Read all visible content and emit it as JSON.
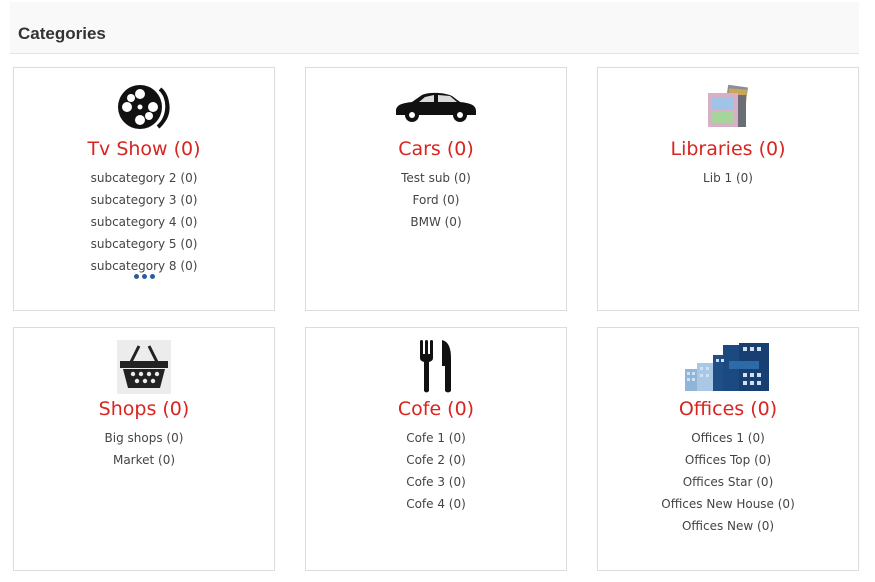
{
  "header": {
    "title": "Categories"
  },
  "more_label": "more",
  "colors": {
    "title": "#d9241f",
    "text": "#444444",
    "more_dots": "#2a5d9f"
  },
  "categories": [
    {
      "icon": "film-reel-icon",
      "title": "Tv Show (0)",
      "items": [
        "subcategory 2 (0)",
        "subcategory 3 (0)",
        "subcategory 4 (0)",
        "subcategory 5 (0)",
        "subcategory 8 (0)"
      ]
    },
    {
      "icon": "car-icon",
      "title": "Cars (0)",
      "items": [
        "Test sub (0)",
        "Ford (0)",
        "BMW (0)"
      ]
    },
    {
      "icon": "books-icon",
      "title": "Libraries (0)",
      "items": [
        "Lib 1 (0)"
      ]
    },
    {
      "icon": "shopping-basket-icon",
      "title": "Shops (0)",
      "items": [
        "Big shops (0)",
        "Market (0)"
      ]
    },
    {
      "icon": "fork-knife-icon",
      "title": "Cofe (0)",
      "items": [
        "Cofe 1 (0)",
        "Cofe 2 (0)",
        "Cofe 3 (0)",
        "Cofe 4 (0)"
      ]
    },
    {
      "icon": "hotel-building-icon",
      "title": "Offices (0)",
      "items": [
        "Offices 1 (0)",
        "Offices Top (0)",
        "Offices Star (0)",
        "Offices New House (0)",
        "Offices New (0)"
      ]
    }
  ]
}
